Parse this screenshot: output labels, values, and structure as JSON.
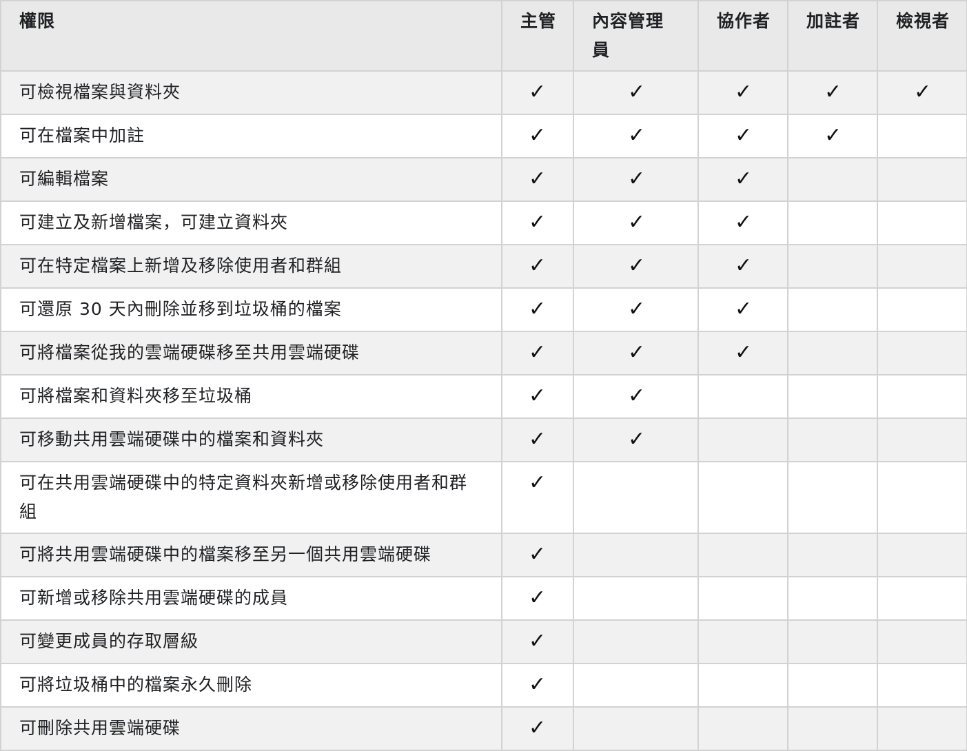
{
  "header": {
    "permission": "權限",
    "roles": [
      "主管",
      "內容管理員",
      "協作者",
      "加註者",
      "檢視者"
    ]
  },
  "check_symbol": "✓",
  "rows": [
    {
      "label": "可檢視檔案與資料夾",
      "checks": [
        true,
        true,
        true,
        true,
        true
      ]
    },
    {
      "label": "可在檔案中加註",
      "checks": [
        true,
        true,
        true,
        true,
        false
      ]
    },
    {
      "label": "可編輯檔案",
      "checks": [
        true,
        true,
        true,
        false,
        false
      ]
    },
    {
      "label": "可建立及新增檔案，可建立資料夾",
      "checks": [
        true,
        true,
        true,
        false,
        false
      ]
    },
    {
      "label": "可在特定檔案上新增及移除使用者和群組",
      "checks": [
        true,
        true,
        true,
        false,
        false
      ]
    },
    {
      "label": "可還原 30 天內刪除並移到垃圾桶的檔案",
      "checks": [
        true,
        true,
        true,
        false,
        false
      ]
    },
    {
      "label": "可將檔案從我的雲端硬碟移至共用雲端硬碟",
      "checks": [
        true,
        true,
        true,
        false,
        false
      ]
    },
    {
      "label": "可將檔案和資料夾移至垃圾桶",
      "checks": [
        true,
        true,
        false,
        false,
        false
      ]
    },
    {
      "label": "可移動共用雲端硬碟中的檔案和資料夾",
      "checks": [
        true,
        true,
        false,
        false,
        false
      ]
    },
    {
      "label": "可在共用雲端硬碟中的特定資料夾新增或移除使用者和群組",
      "checks": [
        true,
        false,
        false,
        false,
        false
      ]
    },
    {
      "label": "可將共用雲端硬碟中的檔案移至另一個共用雲端硬碟",
      "checks": [
        true,
        false,
        false,
        false,
        false
      ]
    },
    {
      "label": "可新增或移除共用雲端硬碟的成員",
      "checks": [
        true,
        false,
        false,
        false,
        false
      ]
    },
    {
      "label": "可變更成員的存取層級",
      "checks": [
        true,
        false,
        false,
        false,
        false
      ]
    },
    {
      "label": "可將垃圾桶中的檔案永久刪除",
      "checks": [
        true,
        false,
        false,
        false,
        false
      ]
    },
    {
      "label": "可刪除共用雲端硬碟",
      "checks": [
        true,
        false,
        false,
        false,
        false
      ]
    }
  ]
}
